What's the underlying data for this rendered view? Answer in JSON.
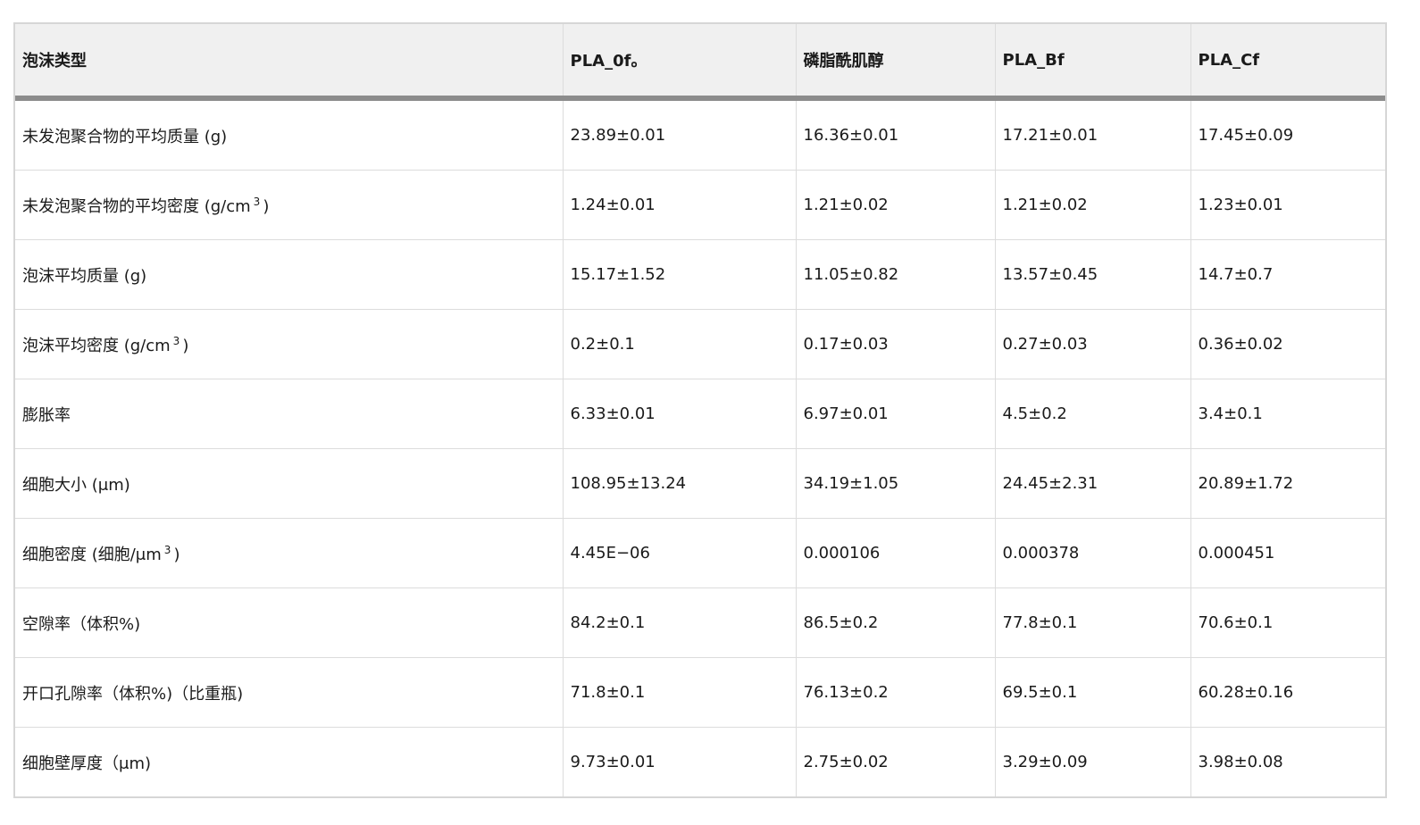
{
  "table": {
    "headers": [
      "泡沫类型",
      "PLA_0f。",
      "磷脂酰肌醇",
      "PLA_Bf",
      "PLA_Cf"
    ],
    "rows": [
      {
        "label": "未发泡聚合物的平均质量 (g)",
        "sup": "",
        "suffix": "",
        "values": [
          "23.89±0.01",
          "16.36±0.01",
          "17.21±0.01",
          "17.45±0.09"
        ]
      },
      {
        "label": "未发泡聚合物的平均密度 (g/cm",
        "sup": "3",
        "suffix": ")",
        "values": [
          "1.24±0.01",
          "1.21±0.02",
          "1.21±0.02",
          "1.23±0.01"
        ]
      },
      {
        "label": "泡沫平均质量 (g)",
        "sup": "",
        "suffix": "",
        "values": [
          "15.17±1.52",
          "11.05±0.82",
          "13.57±0.45",
          "14.7±0.7"
        ]
      },
      {
        "label": "泡沫平均密度 (g/cm",
        "sup": "3",
        "suffix": ")",
        "values": [
          "0.2±0.1",
          "0.17±0.03",
          "0.27±0.03",
          "0.36±0.02"
        ]
      },
      {
        "label": "膨胀率",
        "sup": "",
        "suffix": "",
        "values": [
          "6.33±0.01",
          "6.97±0.01",
          "4.5±0.2",
          "3.4±0.1"
        ]
      },
      {
        "label": "细胞大小 (μm)",
        "sup": "",
        "suffix": "",
        "values": [
          "108.95±13.24",
          "34.19±1.05",
          "24.45±2.31",
          "20.89±1.72"
        ]
      },
      {
        "label": "细胞密度 (细胞/μm",
        "sup": "3",
        "suffix": ")",
        "values": [
          "4.45E−06",
          "0.000106",
          "0.000378",
          "0.000451"
        ]
      },
      {
        "label": "空隙率（体积%)",
        "sup": "",
        "suffix": "",
        "values": [
          "84.2±0.1",
          "86.5±0.2",
          "77.8±0.1",
          "70.6±0.1"
        ]
      },
      {
        "label": "开口孔隙率（体积%)（比重瓶)",
        "sup": "",
        "suffix": "",
        "values": [
          "71.8±0.1",
          "76.13±0.2",
          "69.5±0.1",
          "60.28±0.16"
        ]
      },
      {
        "label": "细胞壁厚度（μm)",
        "sup": "",
        "suffix": "",
        "values": [
          "9.73±0.01",
          "2.75±0.02",
          "3.29±0.09",
          "3.98±0.08"
        ]
      }
    ]
  }
}
